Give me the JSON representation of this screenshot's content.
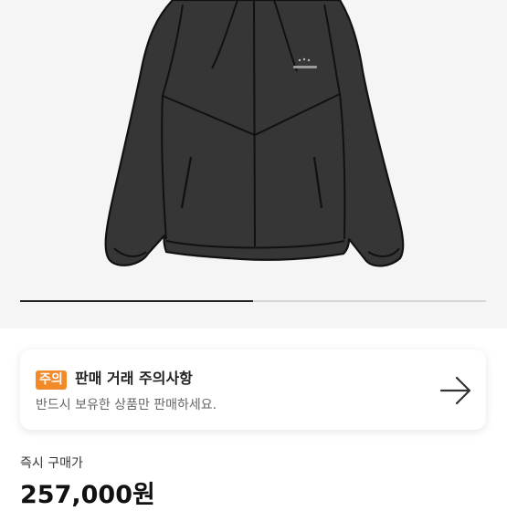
{
  "product": {
    "image": {
      "description": "",
      "carousel_progress": 0.5
    }
  },
  "notice": {
    "badge": "주의",
    "title": "판매 거래 주의사항",
    "description": "반드시 보유한 상품만 판매하세요.",
    "arrow_icon": "arrow-right-icon",
    "badge_color": "#f28a2a"
  },
  "price": {
    "label": "즉시 구매가",
    "value": "257,000원"
  }
}
